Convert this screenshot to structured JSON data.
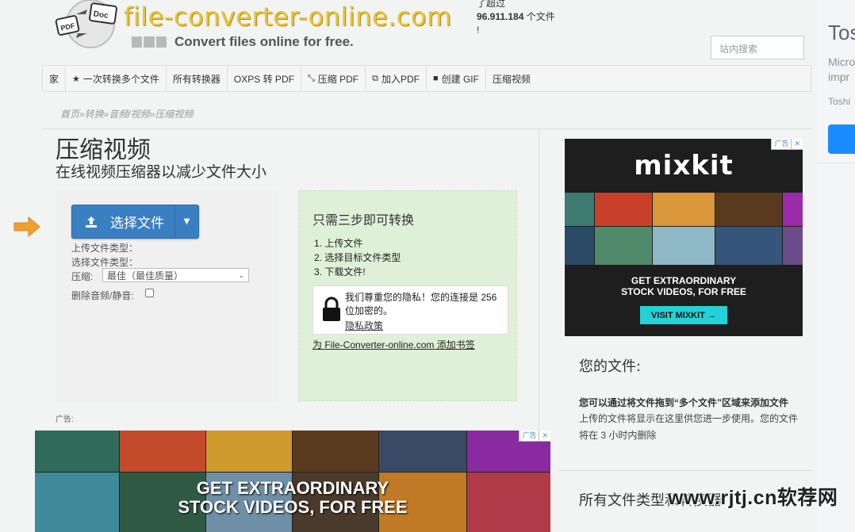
{
  "header": {
    "logo_left": "PDF",
    "logo_right": "Doc",
    "site_name": "file-converter-online.com",
    "tagline": "Convert files online for free.",
    "counter_line1": "了超过",
    "counter_number": "96.911.184",
    "counter_suffix": " 个文件",
    "counter_line3": "!",
    "search_placeholder": "站内搜索"
  },
  "nav": {
    "items": [
      {
        "label": "家",
        "icon": ""
      },
      {
        "label": "一次转换多个文件",
        "icon": "star-icon"
      },
      {
        "label": "所有转换器",
        "icon": ""
      },
      {
        "label": "OXPS 转 PDF",
        "icon": ""
      },
      {
        "label": "压缩 PDF",
        "icon": "compress-icon"
      },
      {
        "label": "加入PDF",
        "icon": "copy-icon"
      },
      {
        "label": "创建 GIF",
        "icon": "video-icon"
      },
      {
        "label": "压缩视频",
        "icon": ""
      }
    ]
  },
  "breadcrumb": "首页»转换»音频/视频»压缩视频",
  "page": {
    "title": "压缩视频",
    "subtitle": "在线视频压缩器以减少文件大小"
  },
  "upload": {
    "button_label": "选择文件",
    "upload_type_label": "上传文件类型：",
    "select_type_label": "选择文件类型：",
    "compress_label": "压缩:",
    "compress_value": "最佳（最佳质量）",
    "remove_audio_label": "删除音频/静音:",
    "remove_audio_checked": false
  },
  "steps": {
    "title": "只需三步即可转换",
    "items": [
      "1. 上传文件",
      "2. 选择目标文件类型",
      "3. 下载文件!"
    ],
    "privacy_text": "我们尊重您的隐私！您的连接是 256 位加密的。",
    "privacy_link": "隐私政策",
    "bookmark_prefix": "为 ",
    "bookmark_site": "File-Converter-online.com",
    "bookmark_suffix": " 添加书签"
  },
  "ad_label": "广告:",
  "ads": {
    "brand": "mixkit",
    "headline_line1": "GET EXTRAORDINARY",
    "headline_line2": "STOCK VIDEOS, FOR FREE",
    "cta": "VISIT MIXKIT →",
    "badge": "广告",
    "close": "✕"
  },
  "files": {
    "title": "您的文件:",
    "bold_line": "您可以通过将文件拖到“多个文件”区域来添加文件",
    "desc": "上传的文件将显示在这里供您进一步使用。您的文件将在 3 小时内删除",
    "all_types_title": "所有文件类型和转换器"
  },
  "side": {
    "title": "Tos",
    "line1": "Micro",
    "line2": "impr",
    "small": "Toshi"
  },
  "watermark": "www.rjtj.cn软荐网",
  "colors": {
    "primary_button": "#3a7fc1",
    "steps_bg": "#dff0d8",
    "site_name": "#e8c33a",
    "arrow": "#f0a030",
    "cta": "#25d1d8"
  }
}
